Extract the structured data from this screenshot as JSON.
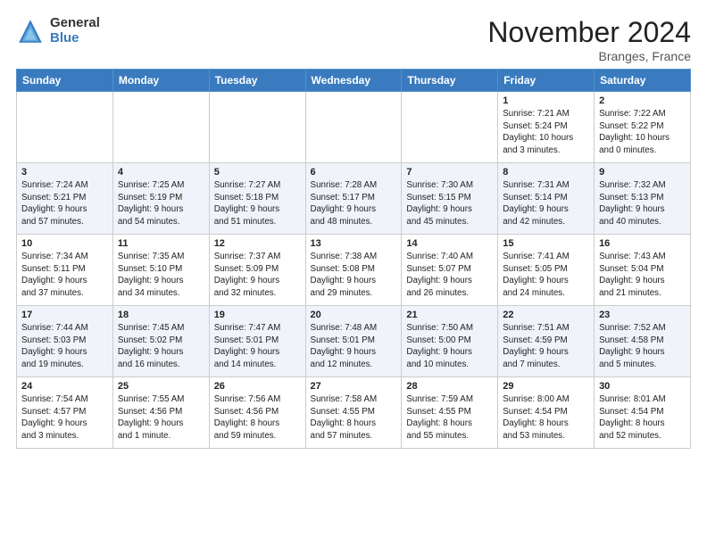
{
  "header": {
    "logo_general": "General",
    "logo_blue": "Blue",
    "month_title": "November 2024",
    "location": "Branges, France"
  },
  "days_of_week": [
    "Sunday",
    "Monday",
    "Tuesday",
    "Wednesday",
    "Thursday",
    "Friday",
    "Saturday"
  ],
  "weeks": [
    [
      {
        "day": "",
        "info": ""
      },
      {
        "day": "",
        "info": ""
      },
      {
        "day": "",
        "info": ""
      },
      {
        "day": "",
        "info": ""
      },
      {
        "day": "",
        "info": ""
      },
      {
        "day": "1",
        "info": "Sunrise: 7:21 AM\nSunset: 5:24 PM\nDaylight: 10 hours\nand 3 minutes."
      },
      {
        "day": "2",
        "info": "Sunrise: 7:22 AM\nSunset: 5:22 PM\nDaylight: 10 hours\nand 0 minutes."
      }
    ],
    [
      {
        "day": "3",
        "info": "Sunrise: 7:24 AM\nSunset: 5:21 PM\nDaylight: 9 hours\nand 57 minutes."
      },
      {
        "day": "4",
        "info": "Sunrise: 7:25 AM\nSunset: 5:19 PM\nDaylight: 9 hours\nand 54 minutes."
      },
      {
        "day": "5",
        "info": "Sunrise: 7:27 AM\nSunset: 5:18 PM\nDaylight: 9 hours\nand 51 minutes."
      },
      {
        "day": "6",
        "info": "Sunrise: 7:28 AM\nSunset: 5:17 PM\nDaylight: 9 hours\nand 48 minutes."
      },
      {
        "day": "7",
        "info": "Sunrise: 7:30 AM\nSunset: 5:15 PM\nDaylight: 9 hours\nand 45 minutes."
      },
      {
        "day": "8",
        "info": "Sunrise: 7:31 AM\nSunset: 5:14 PM\nDaylight: 9 hours\nand 42 minutes."
      },
      {
        "day": "9",
        "info": "Sunrise: 7:32 AM\nSunset: 5:13 PM\nDaylight: 9 hours\nand 40 minutes."
      }
    ],
    [
      {
        "day": "10",
        "info": "Sunrise: 7:34 AM\nSunset: 5:11 PM\nDaylight: 9 hours\nand 37 minutes."
      },
      {
        "day": "11",
        "info": "Sunrise: 7:35 AM\nSunset: 5:10 PM\nDaylight: 9 hours\nand 34 minutes."
      },
      {
        "day": "12",
        "info": "Sunrise: 7:37 AM\nSunset: 5:09 PM\nDaylight: 9 hours\nand 32 minutes."
      },
      {
        "day": "13",
        "info": "Sunrise: 7:38 AM\nSunset: 5:08 PM\nDaylight: 9 hours\nand 29 minutes."
      },
      {
        "day": "14",
        "info": "Sunrise: 7:40 AM\nSunset: 5:07 PM\nDaylight: 9 hours\nand 26 minutes."
      },
      {
        "day": "15",
        "info": "Sunrise: 7:41 AM\nSunset: 5:05 PM\nDaylight: 9 hours\nand 24 minutes."
      },
      {
        "day": "16",
        "info": "Sunrise: 7:43 AM\nSunset: 5:04 PM\nDaylight: 9 hours\nand 21 minutes."
      }
    ],
    [
      {
        "day": "17",
        "info": "Sunrise: 7:44 AM\nSunset: 5:03 PM\nDaylight: 9 hours\nand 19 minutes."
      },
      {
        "day": "18",
        "info": "Sunrise: 7:45 AM\nSunset: 5:02 PM\nDaylight: 9 hours\nand 16 minutes."
      },
      {
        "day": "19",
        "info": "Sunrise: 7:47 AM\nSunset: 5:01 PM\nDaylight: 9 hours\nand 14 minutes."
      },
      {
        "day": "20",
        "info": "Sunrise: 7:48 AM\nSunset: 5:01 PM\nDaylight: 9 hours\nand 12 minutes."
      },
      {
        "day": "21",
        "info": "Sunrise: 7:50 AM\nSunset: 5:00 PM\nDaylight: 9 hours\nand 10 minutes."
      },
      {
        "day": "22",
        "info": "Sunrise: 7:51 AM\nSunset: 4:59 PM\nDaylight: 9 hours\nand 7 minutes."
      },
      {
        "day": "23",
        "info": "Sunrise: 7:52 AM\nSunset: 4:58 PM\nDaylight: 9 hours\nand 5 minutes."
      }
    ],
    [
      {
        "day": "24",
        "info": "Sunrise: 7:54 AM\nSunset: 4:57 PM\nDaylight: 9 hours\nand 3 minutes."
      },
      {
        "day": "25",
        "info": "Sunrise: 7:55 AM\nSunset: 4:56 PM\nDaylight: 9 hours\nand 1 minute."
      },
      {
        "day": "26",
        "info": "Sunrise: 7:56 AM\nSunset: 4:56 PM\nDaylight: 8 hours\nand 59 minutes."
      },
      {
        "day": "27",
        "info": "Sunrise: 7:58 AM\nSunset: 4:55 PM\nDaylight: 8 hours\nand 57 minutes."
      },
      {
        "day": "28",
        "info": "Sunrise: 7:59 AM\nSunset: 4:55 PM\nDaylight: 8 hours\nand 55 minutes."
      },
      {
        "day": "29",
        "info": "Sunrise: 8:00 AM\nSunset: 4:54 PM\nDaylight: 8 hours\nand 53 minutes."
      },
      {
        "day": "30",
        "info": "Sunrise: 8:01 AM\nSunset: 4:54 PM\nDaylight: 8 hours\nand 52 minutes."
      }
    ]
  ]
}
